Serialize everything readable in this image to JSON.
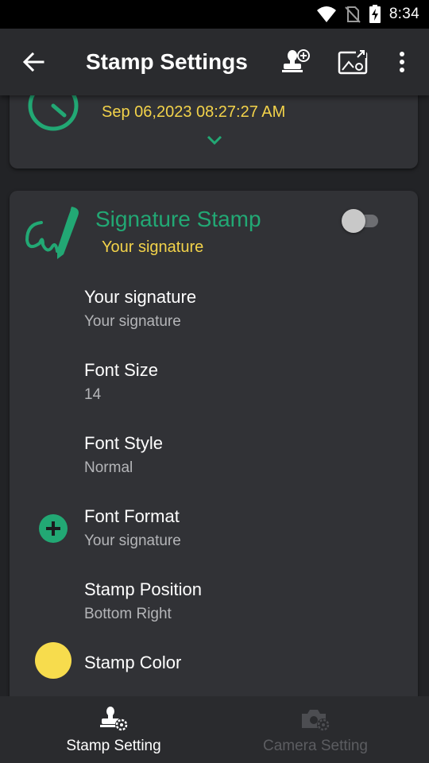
{
  "status_bar": {
    "time": "8:34"
  },
  "app_bar": {
    "title": "Stamp Settings"
  },
  "top_card": {
    "date": "Sep 06,2023 08:27:27 AM"
  },
  "signature_card": {
    "title": "Signature Stamp",
    "subtitle": "Your signature",
    "enabled": false,
    "settings": [
      {
        "label": "Your signature",
        "value": "Your signature"
      },
      {
        "label": "Font Size",
        "value": "14"
      },
      {
        "label": "Font Style",
        "value": "Normal"
      },
      {
        "label": "Font Format",
        "value": "Your signature"
      },
      {
        "label": "Stamp Position",
        "value": "Bottom Right"
      },
      {
        "label": "Stamp Color",
        "value": ""
      }
    ]
  },
  "bottom_nav": {
    "items": [
      {
        "label": "Stamp Setting"
      },
      {
        "label": "Camera Setting"
      }
    ]
  },
  "colors": {
    "accent_green": "#22a874",
    "accent_yellow": "#f3d34a",
    "stamp_color": "#f7dc4d",
    "card_bg": "#313236"
  },
  "icons": [
    "back-arrow-icon",
    "add-stamp-icon",
    "image-settings-icon",
    "more-vert-icon",
    "clock-icon",
    "chevron-down-icon",
    "signature-pen-icon",
    "plus-circle-icon",
    "stamp-settings-icon",
    "camera-settings-icon",
    "wifi-icon",
    "no-sim-icon",
    "battery-charging-icon"
  ]
}
